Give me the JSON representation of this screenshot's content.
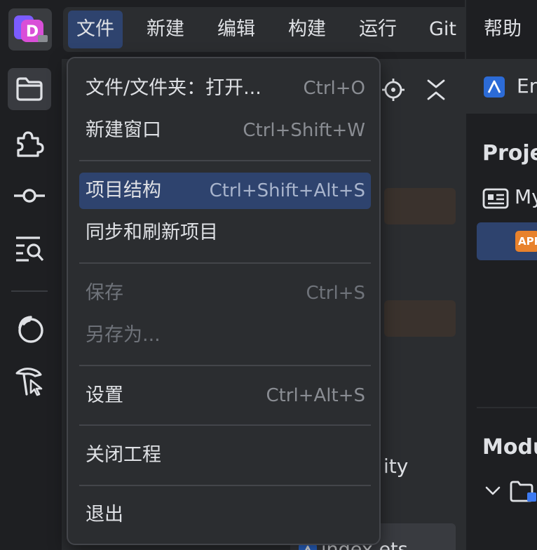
{
  "menubar": {
    "items": [
      {
        "label": "文件",
        "active": true
      },
      {
        "label": "新建"
      },
      {
        "label": "编辑"
      },
      {
        "label": "构建"
      },
      {
        "label": "运行"
      },
      {
        "label": "Git"
      },
      {
        "label": "帮助"
      }
    ]
  },
  "file_menu": {
    "items": [
      {
        "label": "文件/文件夹：打开...",
        "shortcut": "Ctrl+O"
      },
      {
        "label": "新建窗口",
        "shortcut": "Ctrl+Shift+W"
      },
      {
        "label": "项目结构",
        "shortcut": "Ctrl+Shift+Alt+S",
        "highlighted": true
      },
      {
        "label": "同步和刷新项目",
        "shortcut": ""
      },
      {
        "label": "保存",
        "shortcut": "Ctrl+S",
        "disabled": true
      },
      {
        "label": "另存为...",
        "shortcut": "",
        "disabled": true
      },
      {
        "label": "设置",
        "shortcut": "Ctrl+Alt+S"
      },
      {
        "label": "关闭工程",
        "shortcut": ""
      },
      {
        "label": "退出",
        "shortcut": ""
      }
    ]
  },
  "project_panel": {
    "partial_text_1": "ity",
    "tab_label": "index.ets"
  },
  "right_panel": {
    "tab_label": "En",
    "section_project": "Proje",
    "item_label": "My",
    "app_badge": "APP",
    "section_modules": "Modu"
  },
  "colors": {
    "accent": "#2e436e",
    "menu_bg": "#2b2d30",
    "app_bg": "#1e1f22",
    "badge_orange": "#e8822c"
  }
}
